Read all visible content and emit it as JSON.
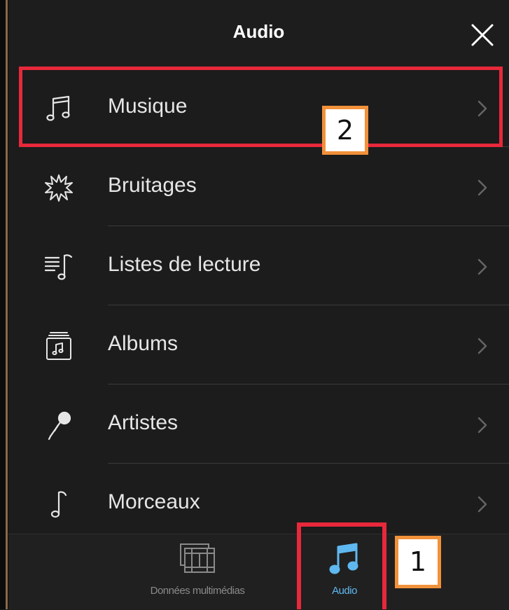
{
  "header": {
    "title": "Audio",
    "close_icon": "close-icon"
  },
  "menu": {
    "items": [
      {
        "label": "Musique",
        "icon": "music-note-icon"
      },
      {
        "label": "Bruitages",
        "icon": "burst-icon"
      },
      {
        "label": "Listes de lecture",
        "icon": "playlist-icon"
      },
      {
        "label": "Albums",
        "icon": "album-icon"
      },
      {
        "label": "Artistes",
        "icon": "microphone-icon"
      },
      {
        "label": "Morceaux",
        "icon": "single-note-icon"
      }
    ]
  },
  "tabbar": {
    "tabs": [
      {
        "label": "Données multimédias",
        "icon": "film-strip-icon",
        "active": false
      },
      {
        "label": "Audio",
        "icon": "music-note-icon",
        "active": true
      }
    ],
    "active_color": "#5fb8f0",
    "inactive_color": "#8a8a8a"
  },
  "annotations": {
    "badge_1": "1",
    "badge_2": "2",
    "highlight_color": "#e8283b",
    "badge_border_color": "#f1913a"
  }
}
